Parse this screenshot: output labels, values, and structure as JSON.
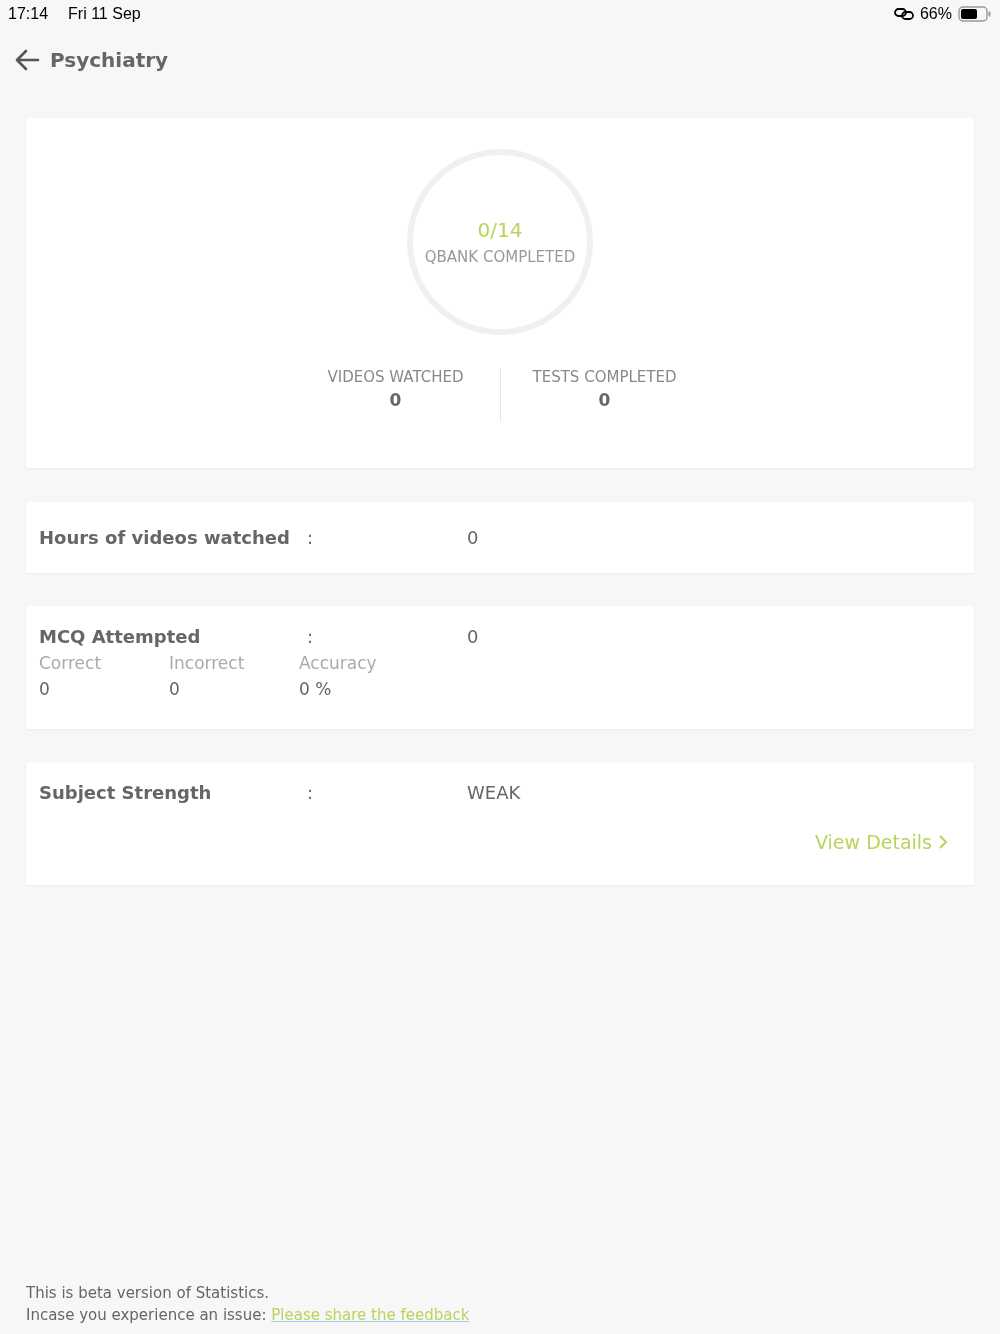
{
  "status_bar": {
    "time": "17:14",
    "date": "Fri 11 Sep",
    "battery": "66%"
  },
  "header": {
    "title": "Psychiatry"
  },
  "summary": {
    "qbank": {
      "value": "0/14",
      "label": "QBANK COMPLETED",
      "level": 0
    },
    "stats": [
      {
        "label": "VIDEOS WATCHED",
        "value": "0"
      },
      {
        "label": "TESTS COMPLETED",
        "value": "0"
      }
    ]
  },
  "hours": {
    "label": "Hours of videos watched",
    "separator": ":",
    "value": "0"
  },
  "mcq": {
    "label": "MCQ Attempted",
    "separator": ":",
    "value": "0",
    "breakdown": [
      {
        "label": "Correct",
        "value": "0"
      },
      {
        "label": "Incorrect",
        "value": "0"
      },
      {
        "label": "Accuracy",
        "value": "0 %"
      }
    ]
  },
  "strength": {
    "label": "Subject Strength",
    "separator": ":",
    "value": "WEAK",
    "link": "View Details"
  },
  "footer": {
    "note": "This is beta version of Statistics.",
    "prompt": "Incase you experience an issue:",
    "link": "Please share the feedback"
  }
}
